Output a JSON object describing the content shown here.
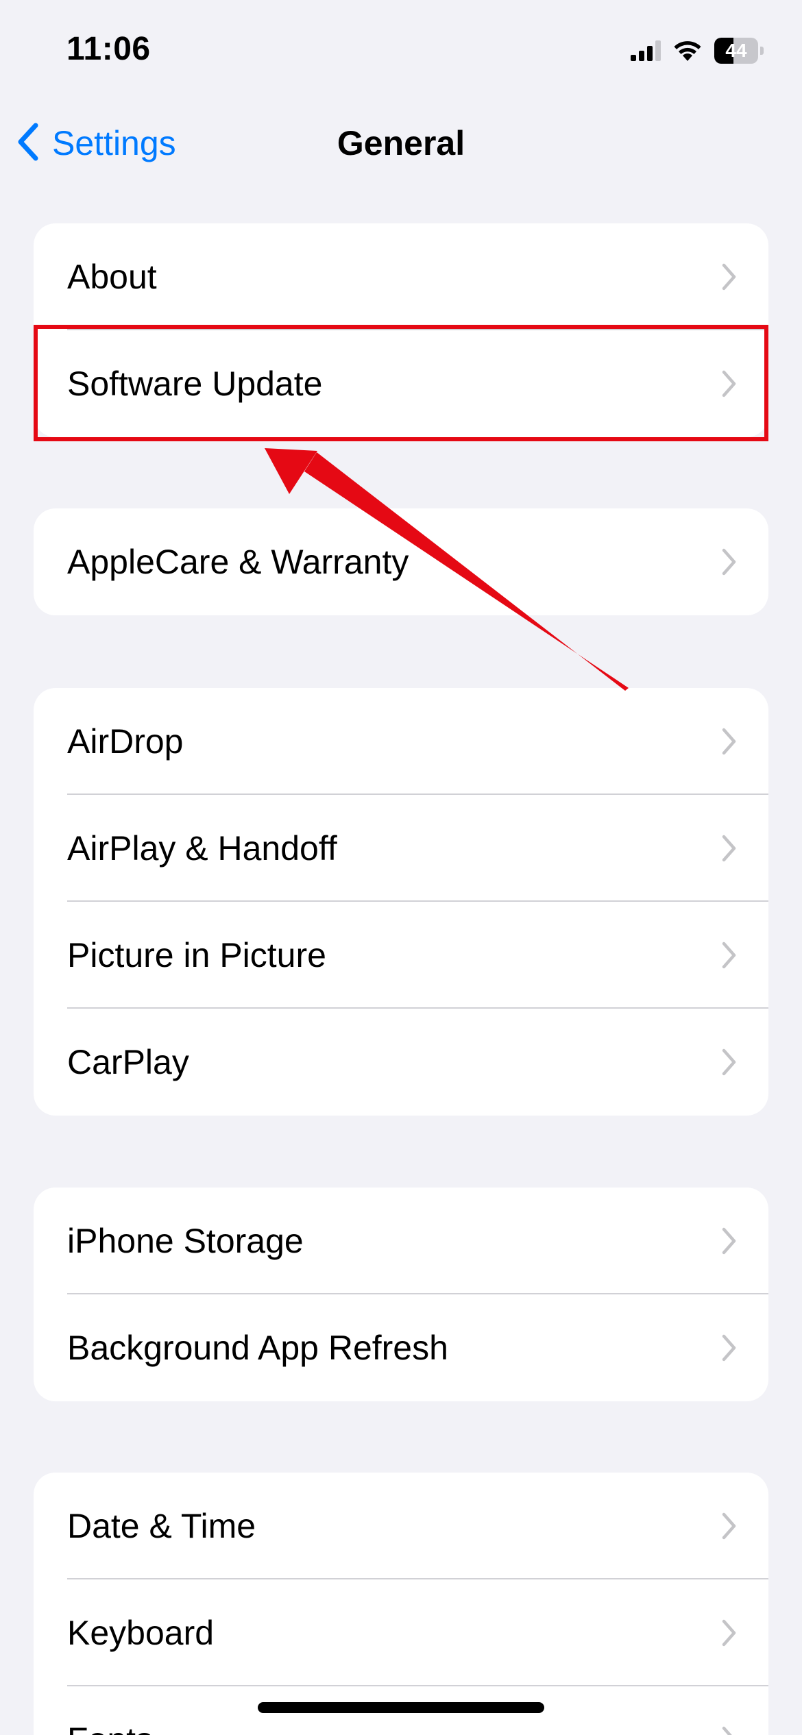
{
  "status_bar": {
    "time": "11:06",
    "battery_level": "44",
    "battery_fraction": 0.44,
    "icons": [
      "signal-icon",
      "wifi-icon",
      "battery-icon"
    ]
  },
  "nav": {
    "back_label": "Settings",
    "title": "General",
    "accent_color": "#007aff"
  },
  "groups": [
    {
      "items": [
        "About",
        "Software Update"
      ]
    },
    {
      "items": [
        "AppleCare & Warranty"
      ]
    },
    {
      "items": [
        "AirDrop",
        "AirPlay & Handoff",
        "Picture in Picture",
        "CarPlay"
      ]
    },
    {
      "items": [
        "iPhone Storage",
        "Background App Refresh"
      ]
    },
    {
      "items": [
        "Date & Time",
        "Keyboard",
        "Fonts"
      ]
    }
  ],
  "annotation": {
    "highlighted_item": "Software Update",
    "color": "#e50914"
  }
}
